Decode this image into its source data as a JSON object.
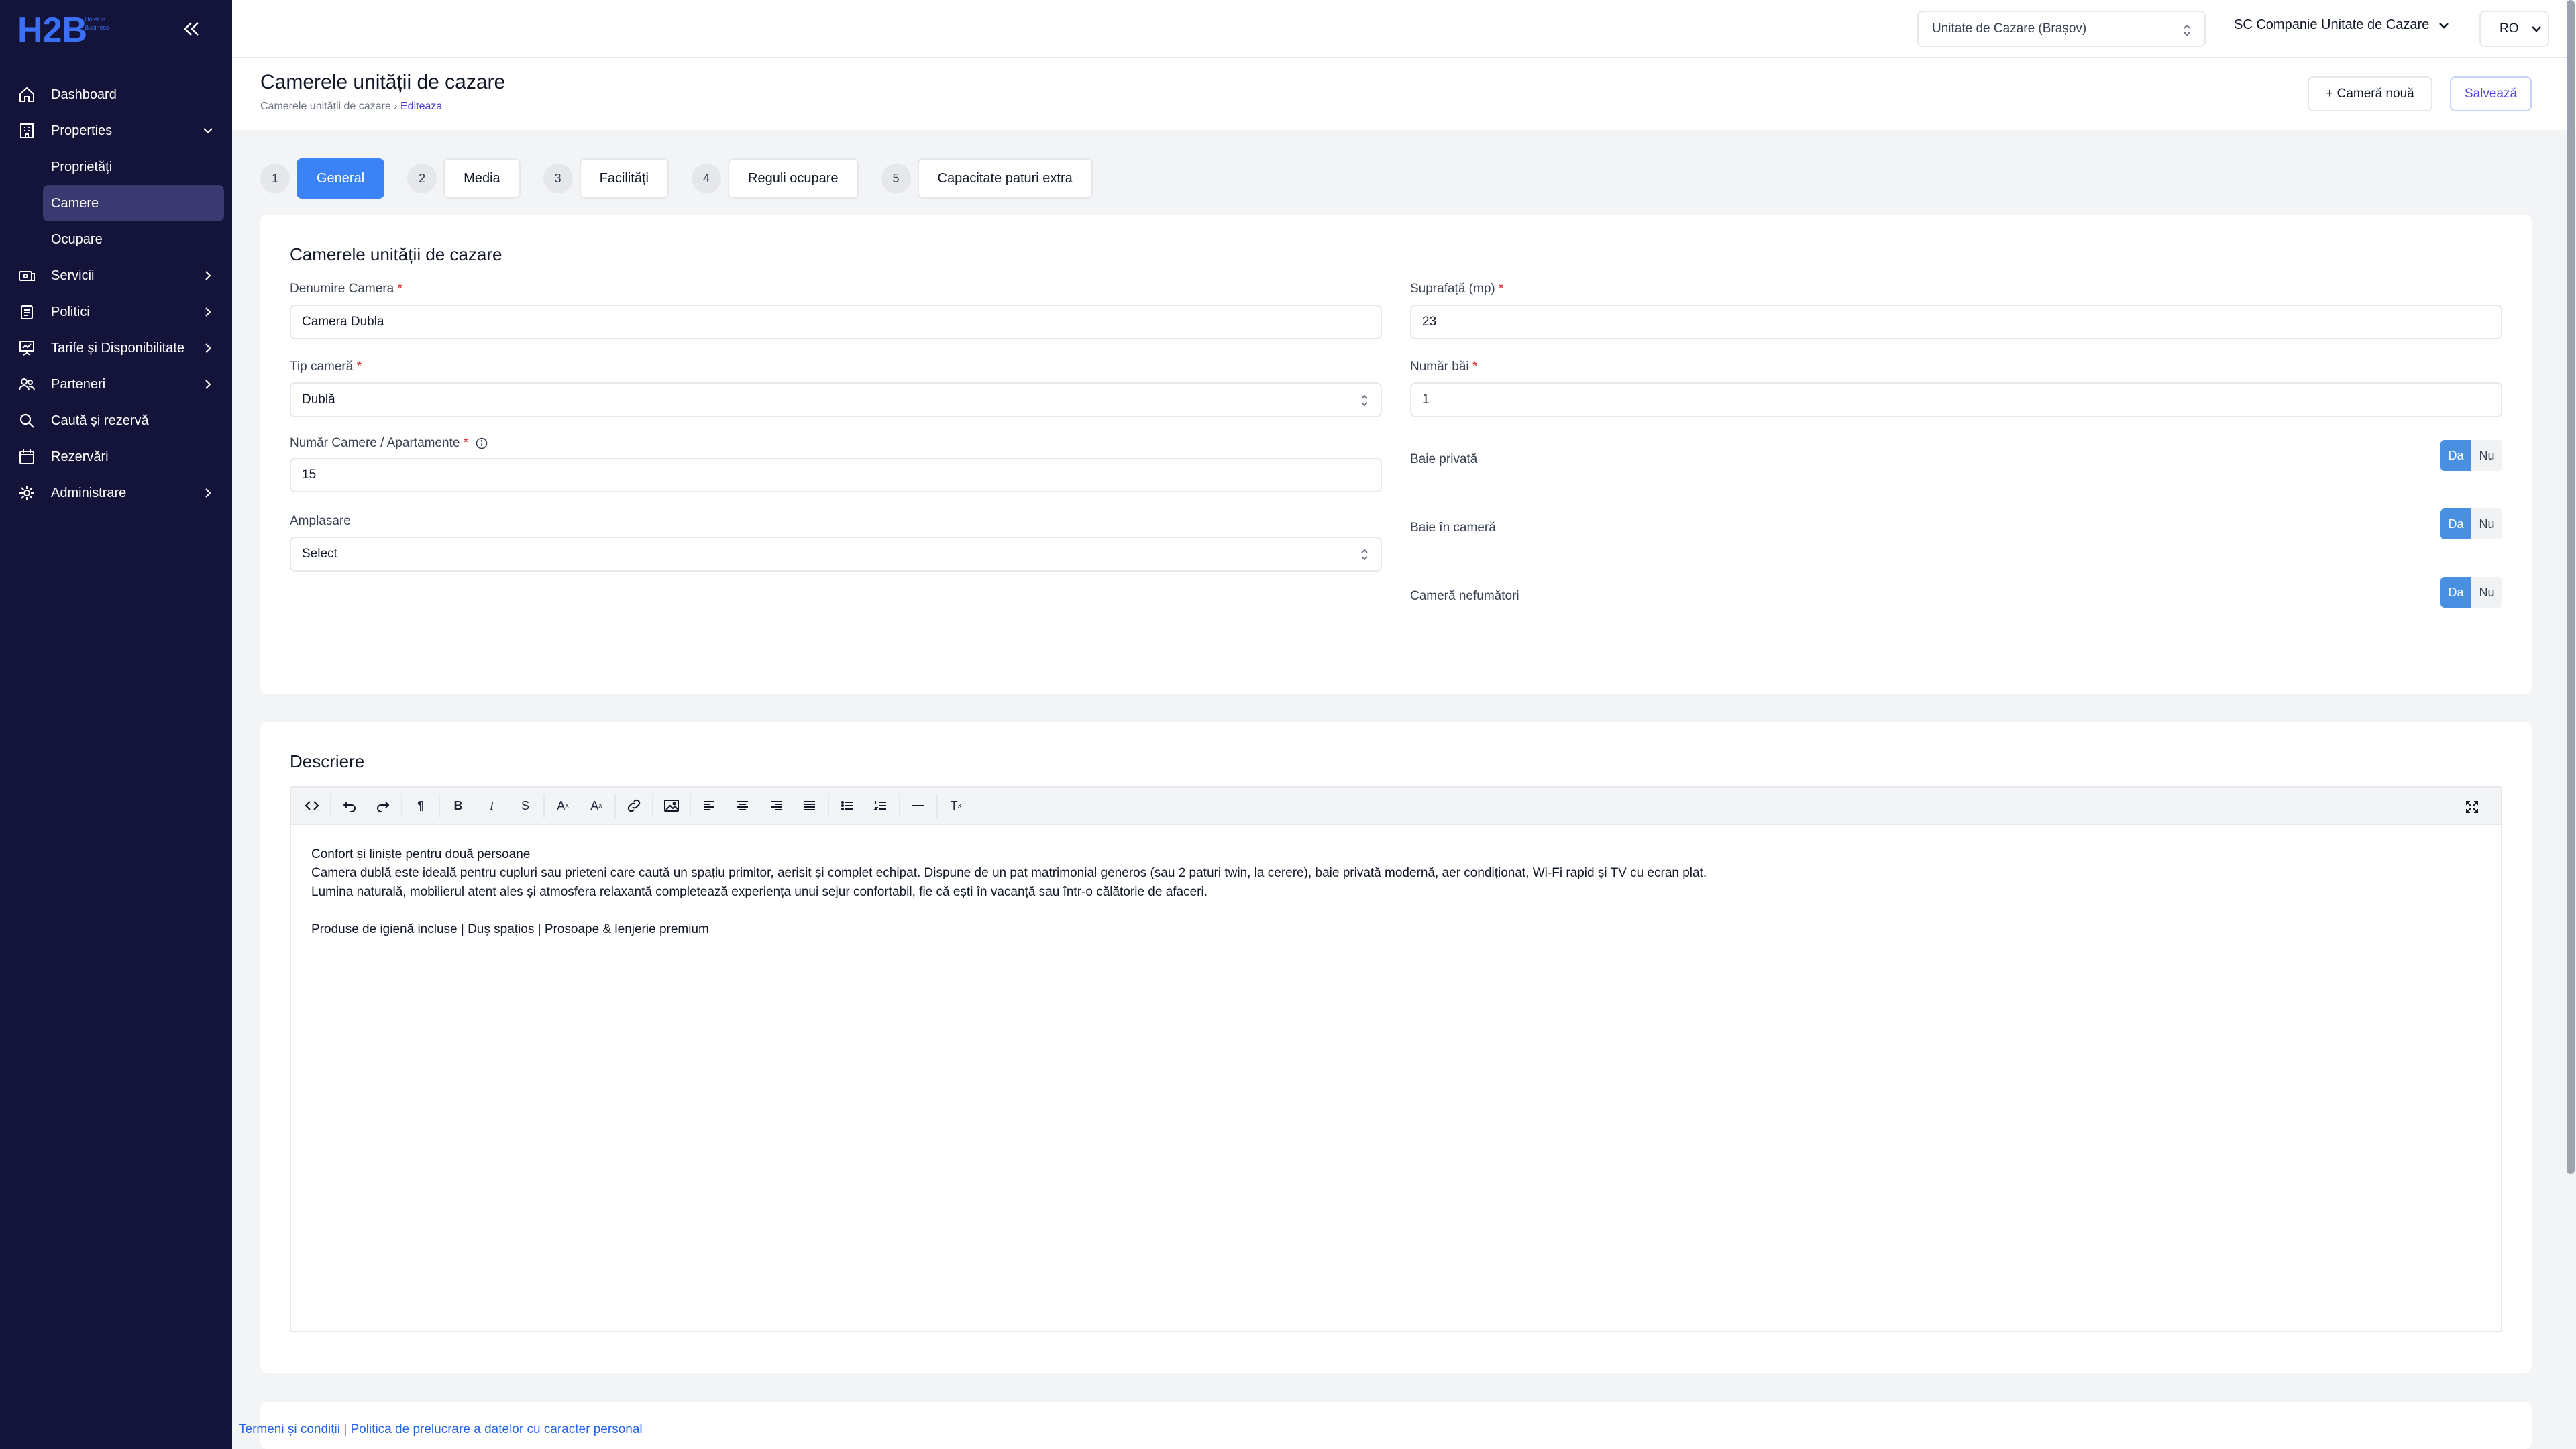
{
  "app": {
    "logo_text": "H2B",
    "logo_sub": "Hotel to Business"
  },
  "sidebar": {
    "items": [
      {
        "label": "Dashboard",
        "icon": "home-icon"
      },
      {
        "label": "Properties",
        "icon": "building-icon"
      },
      {
        "label": "Servicii",
        "icon": "services-icon"
      },
      {
        "label": "Politici",
        "icon": "clipboard-icon"
      },
      {
        "label": "Tarife și Disponibilitate",
        "icon": "presentation-icon"
      },
      {
        "label": "Parteneri",
        "icon": "users-icon"
      },
      {
        "label": "Caută și rezervă",
        "icon": "search-icon"
      },
      {
        "label": "Rezervări",
        "icon": "calendar-icon"
      },
      {
        "label": "Administrare",
        "icon": "settings-icon"
      }
    ],
    "properties_sub": [
      "Proprietăți",
      "Camere",
      "Ocupare"
    ]
  },
  "topbar": {
    "unit": "Unitate de Cazare (Brașov)",
    "company": "SC Companie Unitate de Cazare",
    "lang": "RO"
  },
  "header": {
    "title": "Camerele unității de cazare",
    "breadcrumb_parent": "Camerele unității de cazare",
    "breadcrumb_sep": "›",
    "breadcrumb_current": "Editeaza",
    "new_room": "+ Cameră nouă",
    "save": "Salvează"
  },
  "steps": [
    {
      "num": "1",
      "label": "General"
    },
    {
      "num": "2",
      "label": "Media"
    },
    {
      "num": "3",
      "label": "Facilități"
    },
    {
      "num": "4",
      "label": "Reguli ocupare"
    },
    {
      "num": "5",
      "label": "Capacitate paturi extra"
    }
  ],
  "general": {
    "title": "Camerele unității de cazare",
    "room_name_label": "Denumire Camera",
    "room_name": "Camera Dubla",
    "area_label": "Suprafață (mp)",
    "area": "23",
    "room_type_label": "Tip cameră",
    "room_type": "Dublă",
    "baths_label": "Număr băi",
    "baths": "1",
    "rooms_count_label": "Număr Camere / Apartamente",
    "rooms_count": "15",
    "location_label": "Amplasare",
    "location": "Select",
    "required_mark": "*",
    "private_bath_label": "Baie privată",
    "in_room_bath_label": "Baie în cameră",
    "non_smoking_label": "Cameră nefumători",
    "yes": "Da",
    "no": "Nu"
  },
  "description": {
    "title": "Descriere",
    "line1": "Confort și liniște pentru două persoane",
    "line2": "Camera dublă este ideală pentru cupluri sau prieteni care caută un spațiu primitor, aerisit și complet echipat. Dispune de un pat matrimonial generos (sau 2 paturi twin, la cerere), baie privată modernă, aer condiționat, Wi-Fi rapid și TV cu ecran plat.",
    "line3": "Lumina naturală, mobilierul atent ales și atmosfera relaxantă completează experiența unui sejur confortabil, fie că ești în vacanță sau într-o călătorie de afaceri.",
    "line4": "Produse de igienă incluse | Duș spațios | Prosoape & lenjerie premium"
  },
  "footer": {
    "terms": "Termeni și condiții",
    "sep": "|",
    "privacy": "Politica de prelucrare a datelor cu caracter personal"
  }
}
